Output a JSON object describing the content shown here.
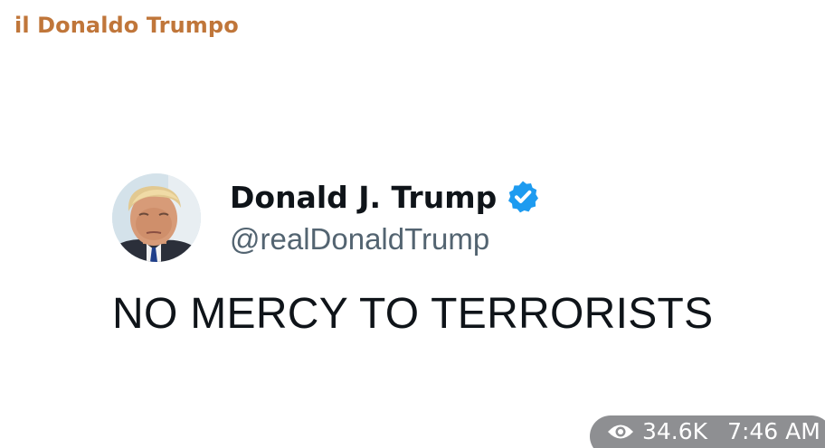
{
  "channel": {
    "name": "il Donaldo Trumpo"
  },
  "tweet": {
    "display_name": "Donald J. Trump",
    "handle": "@realDonaldTrump",
    "text": "NO MERCY TO TERRORISTS",
    "verified_badge_color": "#1d9bf0"
  },
  "meta": {
    "views": "34.6K",
    "time": "7:46 AM",
    "views_icon": "eye-icon"
  }
}
